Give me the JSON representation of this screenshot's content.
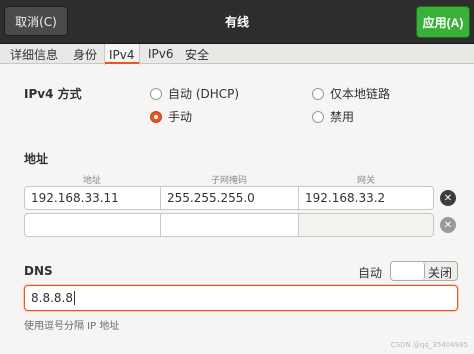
{
  "header": {
    "cancel_label": "取消(C)",
    "title": "有线",
    "apply_label": "应用(A)"
  },
  "tabs": [
    {
      "label": "详细信息"
    },
    {
      "label": "身份"
    },
    {
      "label": "IPv4"
    },
    {
      "label": "IPv6"
    },
    {
      "label": "安全"
    }
  ],
  "ipv4": {
    "method_label": "IPv4 方式",
    "methods": [
      {
        "label": "自动 (DHCP)",
        "checked": false
      },
      {
        "label": "仅本地链路",
        "checked": false
      },
      {
        "label": "手动",
        "checked": true
      },
      {
        "label": "禁用",
        "checked": false
      }
    ]
  },
  "address": {
    "section_label": "地址",
    "column_headers": [
      "地址",
      "子网掩码",
      "网关"
    ],
    "rows": [
      {
        "address": "192.168.33.11",
        "netmask": "255.255.255.0",
        "gateway": "192.168.33.2"
      },
      {
        "address": "",
        "netmask": "",
        "gateway": ""
      }
    ]
  },
  "dns": {
    "label": "DNS",
    "auto_label": "自动",
    "switch_state": "关闭",
    "value": "8.8.8.8",
    "hint": "使用逗号分隔 IP 地址"
  },
  "watermark": "CSDN @qq_35404985",
  "colors": {
    "accent": "#e95420",
    "apply": "#3ab03a",
    "header_bg": "#2d2d2d"
  }
}
